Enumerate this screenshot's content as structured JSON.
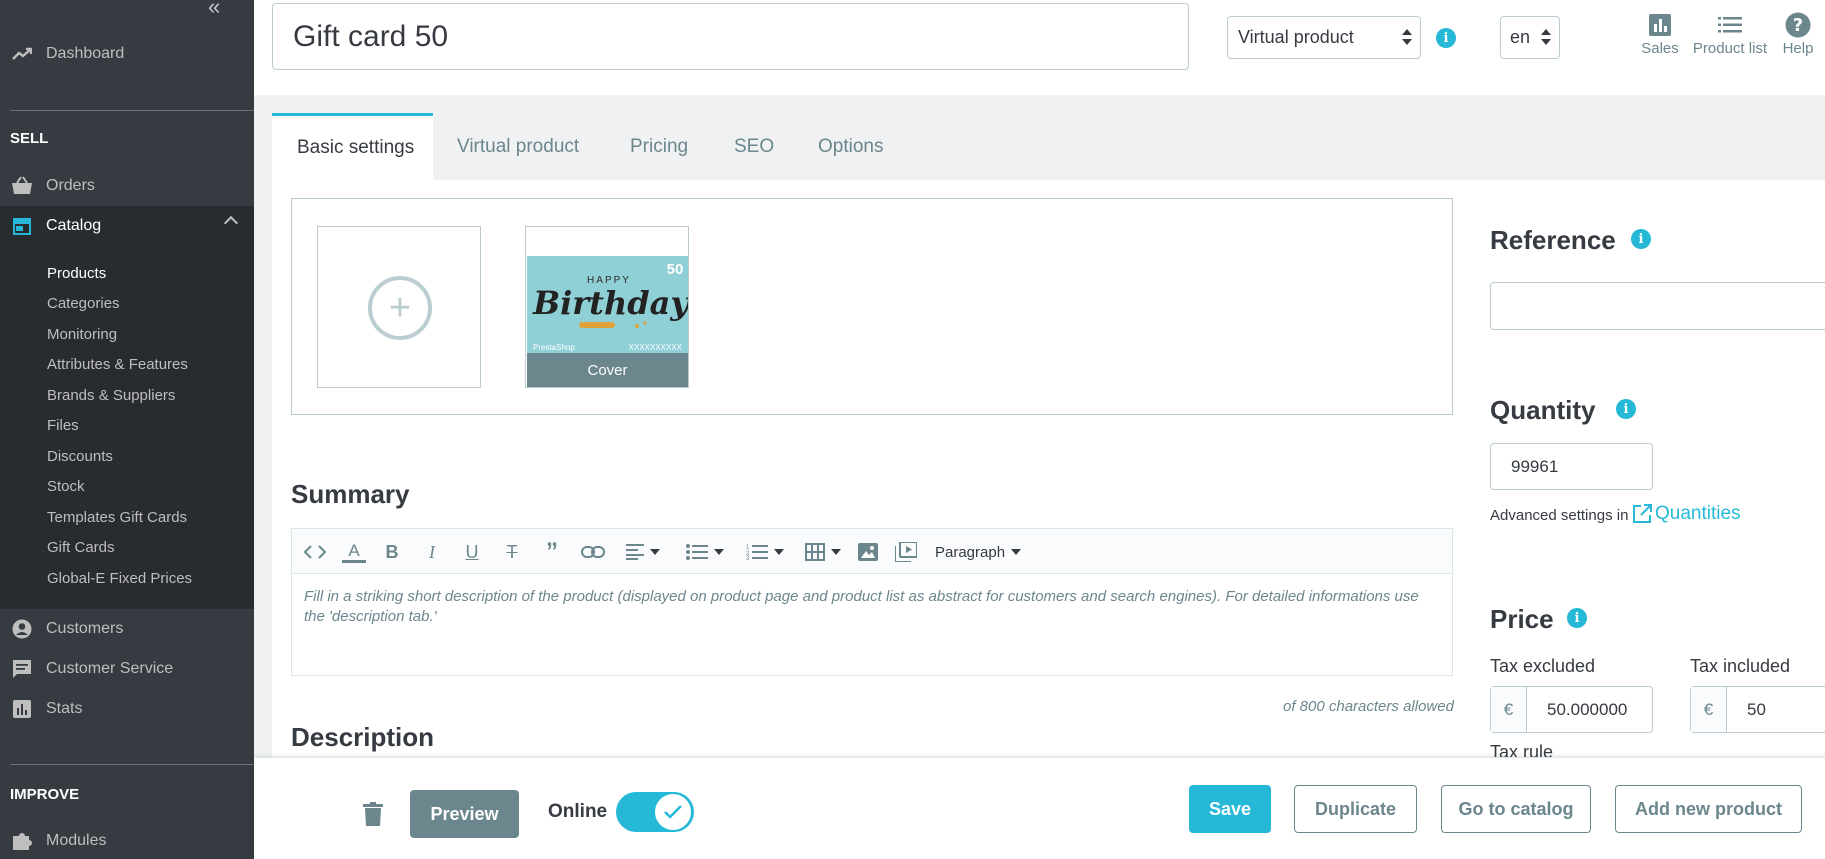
{
  "sidebar": {
    "collapse_icon": "«",
    "dashboard": "Dashboard",
    "sell_heading": "SELL",
    "orders": "Orders",
    "catalog": "Catalog",
    "catalog_items": [
      "Products",
      "Categories",
      "Monitoring",
      "Attributes & Features",
      "Brands & Suppliers",
      "Files",
      "Discounts",
      "Stock",
      "Templates Gift Cards",
      "Gift Cards",
      "Global-E Fixed Prices"
    ],
    "customers": "Customers",
    "customer_service": "Customer Service",
    "stats": "Stats",
    "improve_heading": "IMPROVE",
    "modules": "Modules"
  },
  "header": {
    "product_name": "Gift card 50",
    "product_type": "Virtual product",
    "language": "en",
    "toolbar": {
      "sales": "Sales",
      "product_list": "Product list",
      "help": "Help"
    }
  },
  "tabs": [
    "Basic settings",
    "Virtual product",
    "Pricing",
    "SEO",
    "Options"
  ],
  "images": {
    "cover_label": "Cover",
    "card": {
      "value": "50",
      "line1": "HAPPY",
      "line2": "Birthday",
      "footer_left": "PrestaShop",
      "footer_right": "XXXXXXXXXX"
    }
  },
  "summary": {
    "title": "Summary",
    "format_select": "Paragraph",
    "placeholder": "Fill in a striking short description of the product (displayed on product page and product list as abstract for customers and search engines). For detailed informations use the 'description tab.'",
    "char_count": "of 800 characters allowed"
  },
  "description": {
    "title": "Description"
  },
  "reference": {
    "title": "Reference",
    "value": ""
  },
  "quantity": {
    "title": "Quantity",
    "value": "99961",
    "advanced_text": "Advanced settings in",
    "link": "Quantities"
  },
  "price": {
    "title": "Price",
    "tax_excluded_label": "Tax excluded",
    "tax_excluded_value": "50.000000",
    "tax_included_label": "Tax included",
    "tax_included_value": "50",
    "currency": "€",
    "tax_rule_label": "Tax rule"
  },
  "footer": {
    "preview": "Preview",
    "online": "Online",
    "online_enabled": true,
    "save": "Save",
    "duplicate": "Duplicate",
    "go_to_catalog": "Go to catalog",
    "add_new_product": "Add new product"
  },
  "colors": {
    "accent": "#25b9d7",
    "sidebar": "#363a41",
    "muted": "#6c868e"
  }
}
